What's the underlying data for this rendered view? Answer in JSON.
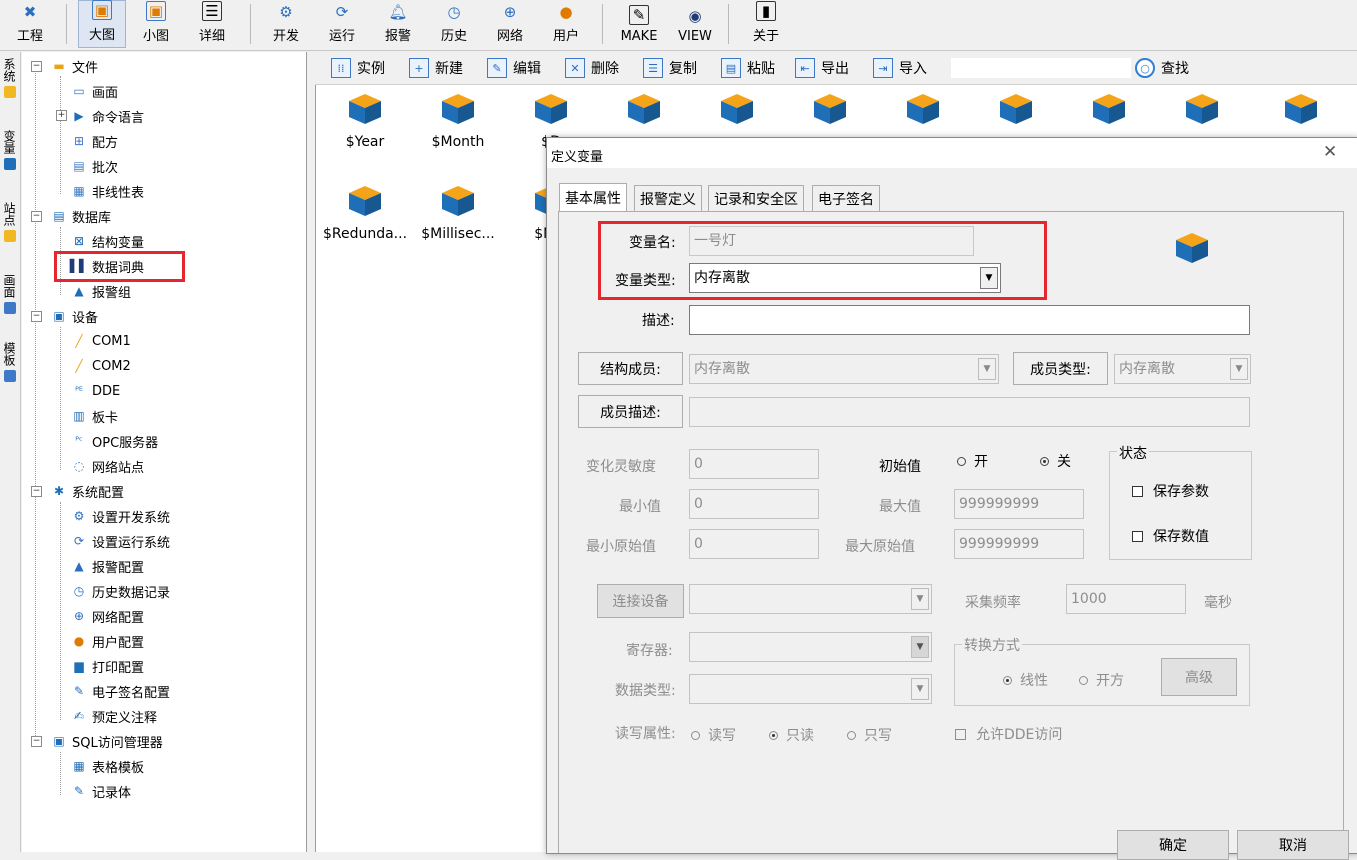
{
  "toolbar": {
    "items": [
      "工程",
      "大图",
      "小图",
      "详细",
      "开发",
      "运行",
      "报警",
      "历史",
      "网络",
      "用户",
      "MAKE",
      "VIEW",
      "关于"
    ]
  },
  "vtabs": [
    "系统",
    "变量",
    "站点",
    "画面",
    "模板"
  ],
  "tree": {
    "file": "文件",
    "file_children": [
      "画面",
      "命令语言",
      "配方",
      "批次",
      "非线性表"
    ],
    "database": "数据库",
    "database_children": [
      "结构变量",
      "数据词典",
      "报警组"
    ],
    "device": "设备",
    "device_children": [
      "COM1",
      "COM2",
      "DDE",
      "板卡",
      "OPC服务器",
      "网络站点"
    ],
    "sysconfig": "系统配置",
    "sysconfig_children": [
      "设置开发系统",
      "设置运行系统",
      "报警配置",
      "历史数据记录",
      "网络配置",
      "用户配置",
      "打印配置",
      "电子签名配置",
      "预定义注释"
    ],
    "sql": "SQL访问管理器",
    "sql_children": [
      "表格模板",
      "记录体"
    ]
  },
  "main_toolbar": {
    "buttons": [
      "实例",
      "新建",
      "编辑",
      "删除",
      "复制",
      "粘贴",
      "导出",
      "导入"
    ],
    "search_label": "查找",
    "search_value": ""
  },
  "variables": {
    "row1": [
      "$Year",
      "$Month",
      "$D"
    ],
    "row2": [
      "$Redunda...",
      "$Millisec...",
      "$Net"
    ]
  },
  "dialog": {
    "title": "定义变量",
    "close": "✕",
    "tabs": [
      "基本属性",
      "报警定义",
      "记录和安全区",
      "电子签名"
    ],
    "var_name_label": "变量名:",
    "var_name_value": "一号灯",
    "var_type_label": "变量类型:",
    "var_type_value": "内存离散",
    "desc_label": "描述:",
    "desc_value": "",
    "struct_member_label": "结构成员:",
    "struct_member_value": "内存离散",
    "member_type_label": "成员类型:",
    "member_type_value": "内存离散",
    "member_desc_label": "成员描述:",
    "sensitivity_label": "变化灵敏度",
    "sensitivity_value": "0",
    "initial_label": "初始值",
    "initial_on": "开",
    "initial_off": "关",
    "status_group": "状态",
    "save_param": "保存参数",
    "save_value": "保存数值",
    "min_label": "最小值",
    "min_value": "0",
    "max_label": "最大值",
    "max_value": "999999999",
    "min_raw_label": "最小原始值",
    "min_raw_value": "0",
    "max_raw_label": "最大原始值",
    "max_raw_value": "999999999",
    "connect_device": "连接设备",
    "sample_rate_label": "采集频率",
    "sample_rate_value": "1000",
    "ms_label": "毫秒",
    "register_label": "寄存器:",
    "convert_group": "转换方式",
    "linear": "线性",
    "sqrt": "开方",
    "advanced": "高级",
    "data_type_label": "数据类型:",
    "rw_label": "读写属性:",
    "rw_options": [
      "读写",
      "只读",
      "只写"
    ],
    "allow_dde": "允许DDE访问",
    "ok": "确定",
    "cancel": "取消"
  },
  "colors": {
    "highlight": "#e5262e",
    "cube_orange": "#f5a41a",
    "cube_blue": "#1f6fb8"
  }
}
